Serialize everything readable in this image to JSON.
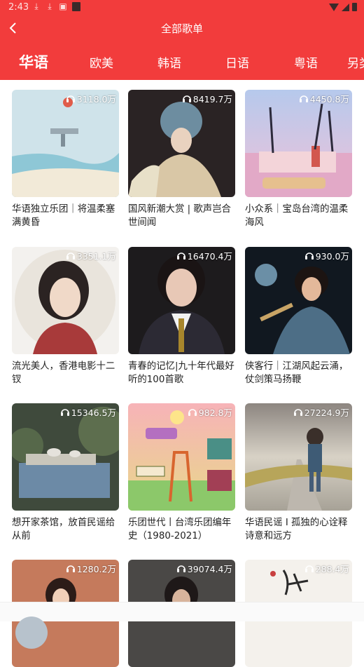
{
  "status_bar": {
    "time": "2:43"
  },
  "header": {
    "title": "全部歌单"
  },
  "tabs": [
    "华语",
    "欧美",
    "韩语",
    "日语",
    "粤语",
    "另类"
  ],
  "playlists": [
    {
      "plays": "3118.0万",
      "title": "华语独立乐团｜将温柔塞满黄昏"
    },
    {
      "plays": "8419.7万",
      "title": "国风新潮大赏 | 歌声岂合世间闻"
    },
    {
      "plays": "4450.8万",
      "title": "小众系｜宝岛台湾的温柔海风"
    },
    {
      "plays": "3351.1万",
      "title": "流光美人，香港电影十二钗"
    },
    {
      "plays": "16470.4万",
      "title": "青春的记忆|九十年代最好听的100首歌"
    },
    {
      "plays": "930.0万",
      "title": "侠客行｜江湖风起云涌，仗剑策马扬鞭"
    },
    {
      "plays": "15346.5万",
      "title": "想开家茶馆，放首民谣给从前"
    },
    {
      "plays": "982.8万",
      "title": "乐团世代丨台湾乐团编年史（1980-2021）"
    },
    {
      "plays": "27224.9万",
      "title": "华语民谣 I 孤独的心诠释诗意和远方"
    },
    {
      "plays": "1280.2万",
      "title": ""
    },
    {
      "plays": "39074.4万",
      "title": ""
    },
    {
      "plays": "288.4万",
      "title": ""
    }
  ],
  "colors": {
    "brand": "#f23c3c"
  }
}
